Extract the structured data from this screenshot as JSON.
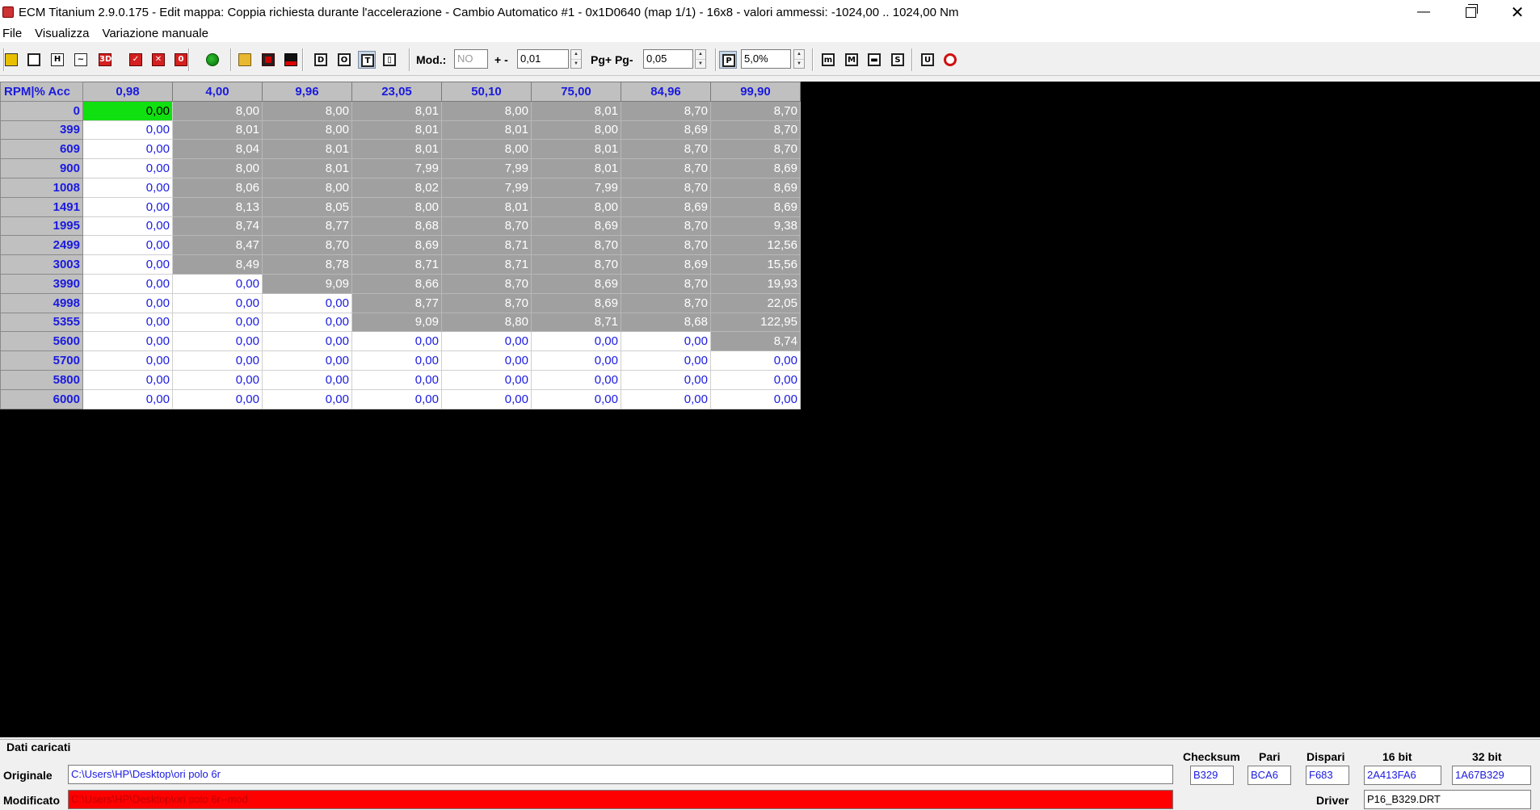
{
  "window": {
    "title": "ECM Titanium 2.9.0.175 - Edit mappa: Coppia richiesta durante l'accelerazione - Cambio Automatico #1 - 0x1D0640 (map 1/1) - 16x8 - valori ammessi: -1024,00 .. 1024,00 Nm"
  },
  "menu": [
    "File",
    "Visualizza",
    "Variazione manuale"
  ],
  "toolbar": {
    "mod_label": "Mod.:",
    "mod_value": "NO",
    "plusminus_label": "+ -",
    "step_value": "0,01",
    "pg_label": "Pg+ Pg-",
    "pg_value": "0,05",
    "percent_value": "5,0%",
    "icons": [
      {
        "name": "home-icon",
        "glyph": "",
        "cls": "ic-house"
      },
      {
        "name": "copy-map-icon",
        "glyph": "",
        "cls": "ic-doc2"
      },
      {
        "name": "hex-view-icon",
        "glyph": "H",
        "cls": "ic-doc"
      },
      {
        "name": "graph-2d-icon",
        "glyph": "~",
        "cls": "ic-doc"
      },
      {
        "name": "graph-3d-icon",
        "glyph": "3D",
        "cls": "ic-red"
      },
      {
        "name": "check-map-icon",
        "glyph": "✓",
        "cls": "ic-red"
      },
      {
        "name": "reset-map-icon",
        "glyph": "✕",
        "cls": "ic-red"
      },
      {
        "name": "zero-map-icon",
        "glyph": "0",
        "cls": "ic-red"
      },
      {
        "name": "color-map-icon",
        "glyph": "",
        "cls": "ic-green"
      },
      {
        "name": "open-folder-icon",
        "glyph": "",
        "cls": "ic-folder"
      },
      {
        "name": "save-icon",
        "glyph": "",
        "cls": "ic-save"
      },
      {
        "name": "save-as-icon",
        "glyph": "",
        "cls": "ic-save2"
      },
      {
        "name": "display-decimal-icon",
        "glyph": "D",
        "cls": "ic-frame"
      },
      {
        "name": "display-original-icon",
        "glyph": "O",
        "cls": "ic-frame"
      },
      {
        "name": "display-text-icon",
        "glyph": "T",
        "cls": "ic-frame"
      },
      {
        "name": "display-columns-icon",
        "glyph": "▯",
        "cls": "ic-frame"
      },
      {
        "name": "percent-mode-icon",
        "glyph": "P",
        "cls": "ic-frame"
      },
      {
        "name": "min-icon",
        "glyph": "m",
        "cls": "ic-frame"
      },
      {
        "name": "max-icon",
        "glyph": "M",
        "cls": "ic-frame"
      },
      {
        "name": "color-scale-icon",
        "glyph": "▬",
        "cls": "ic-frame"
      },
      {
        "name": "smooth-icon",
        "glyph": "S",
        "cls": "ic-frame"
      },
      {
        "name": "undo-icon",
        "glyph": "U",
        "cls": "ic-frame"
      },
      {
        "name": "refresh-icon",
        "glyph": "",
        "cls": "ic-circ"
      }
    ]
  },
  "map": {
    "corner_label": "RPM|% Acc",
    "columns": [
      "0,98",
      "4,00",
      "9,96",
      "23,05",
      "50,10",
      "75,00",
      "84,96",
      "99,90"
    ],
    "rows": [
      {
        "rpm": "0",
        "values": [
          "0,00",
          "8,00",
          "8,00",
          "8,01",
          "8,00",
          "8,01",
          "8,70",
          "8,70"
        ],
        "gray": [
          false,
          true,
          true,
          true,
          true,
          true,
          true,
          true
        ]
      },
      {
        "rpm": "399",
        "values": [
          "0,00",
          "8,01",
          "8,00",
          "8,01",
          "8,01",
          "8,00",
          "8,69",
          "8,70"
        ],
        "gray": [
          false,
          true,
          true,
          true,
          true,
          true,
          true,
          true
        ]
      },
      {
        "rpm": "609",
        "values": [
          "0,00",
          "8,04",
          "8,01",
          "8,01",
          "8,00",
          "8,01",
          "8,70",
          "8,70"
        ],
        "gray": [
          false,
          true,
          true,
          true,
          true,
          true,
          true,
          true
        ]
      },
      {
        "rpm": "900",
        "values": [
          "0,00",
          "8,00",
          "8,01",
          "7,99",
          "7,99",
          "8,01",
          "8,70",
          "8,69"
        ],
        "gray": [
          false,
          true,
          true,
          true,
          true,
          true,
          true,
          true
        ]
      },
      {
        "rpm": "1008",
        "values": [
          "0,00",
          "8,06",
          "8,00",
          "8,02",
          "7,99",
          "7,99",
          "8,70",
          "8,69"
        ],
        "gray": [
          false,
          true,
          true,
          true,
          true,
          true,
          true,
          true
        ]
      },
      {
        "rpm": "1491",
        "values": [
          "0,00",
          "8,13",
          "8,05",
          "8,00",
          "8,01",
          "8,00",
          "8,69",
          "8,69"
        ],
        "gray": [
          false,
          true,
          true,
          true,
          true,
          true,
          true,
          true
        ]
      },
      {
        "rpm": "1995",
        "values": [
          "0,00",
          "8,74",
          "8,77",
          "8,68",
          "8,70",
          "8,69",
          "8,70",
          "9,38"
        ],
        "gray": [
          false,
          true,
          true,
          true,
          true,
          true,
          true,
          true
        ]
      },
      {
        "rpm": "2499",
        "values": [
          "0,00",
          "8,47",
          "8,70",
          "8,69",
          "8,71",
          "8,70",
          "8,70",
          "12,56"
        ],
        "gray": [
          false,
          true,
          true,
          true,
          true,
          true,
          true,
          true
        ]
      },
      {
        "rpm": "3003",
        "values": [
          "0,00",
          "8,49",
          "8,78",
          "8,71",
          "8,71",
          "8,70",
          "8,69",
          "15,56"
        ],
        "gray": [
          false,
          true,
          true,
          true,
          true,
          true,
          true,
          true
        ]
      },
      {
        "rpm": "3990",
        "values": [
          "0,00",
          "0,00",
          "9,09",
          "8,66",
          "8,70",
          "8,69",
          "8,70",
          "19,93"
        ],
        "gray": [
          false,
          false,
          true,
          true,
          true,
          true,
          true,
          true
        ]
      },
      {
        "rpm": "4998",
        "values": [
          "0,00",
          "0,00",
          "0,00",
          "8,77",
          "8,70",
          "8,69",
          "8,70",
          "22,05"
        ],
        "gray": [
          false,
          false,
          false,
          true,
          true,
          true,
          true,
          true
        ]
      },
      {
        "rpm": "5355",
        "values": [
          "0,00",
          "0,00",
          "0,00",
          "9,09",
          "8,80",
          "8,71",
          "8,68",
          "122,95"
        ],
        "gray": [
          false,
          false,
          false,
          true,
          true,
          true,
          true,
          true
        ]
      },
      {
        "rpm": "5600",
        "values": [
          "0,00",
          "0,00",
          "0,00",
          "0,00",
          "0,00",
          "0,00",
          "0,00",
          "8,74"
        ],
        "gray": [
          false,
          false,
          false,
          false,
          false,
          false,
          false,
          true
        ]
      },
      {
        "rpm": "5700",
        "values": [
          "0,00",
          "0,00",
          "0,00",
          "0,00",
          "0,00",
          "0,00",
          "0,00",
          "0,00"
        ],
        "gray": [
          false,
          false,
          false,
          false,
          false,
          false,
          false,
          false
        ]
      },
      {
        "rpm": "5800",
        "values": [
          "0,00",
          "0,00",
          "0,00",
          "0,00",
          "0,00",
          "0,00",
          "0,00",
          "0,00"
        ],
        "gray": [
          false,
          false,
          false,
          false,
          false,
          false,
          false,
          false
        ]
      },
      {
        "rpm": "6000",
        "values": [
          "0,00",
          "0,00",
          "0,00",
          "0,00",
          "0,00",
          "0,00",
          "0,00",
          "0,00"
        ],
        "gray": [
          false,
          false,
          false,
          false,
          false,
          false,
          false,
          false
        ]
      }
    ],
    "selected": {
      "row": 0,
      "col": 0
    }
  },
  "status": {
    "section_label": "Dati caricati",
    "original_label": "Originale",
    "original_path": "C:\\Users\\HP\\Desktop\\ori polo 6r",
    "modified_label": "Modificato",
    "modified_path": "C:\\Users\\HP\\Desktop\\ori polo 6r--mod",
    "checksum_label": "Checksum",
    "checksum_value": "B329",
    "pari_label": "Pari",
    "pari_value": "BCA6",
    "dispari_label": "Dispari",
    "dispari_value": "F683",
    "bit16_label": "16 bit",
    "bit16_value": "2A413FA6",
    "bit32_label": "32 bit",
    "bit32_value": "1A67B329",
    "driver_label": "Driver",
    "driver_value": "P16_B329.DRT"
  }
}
